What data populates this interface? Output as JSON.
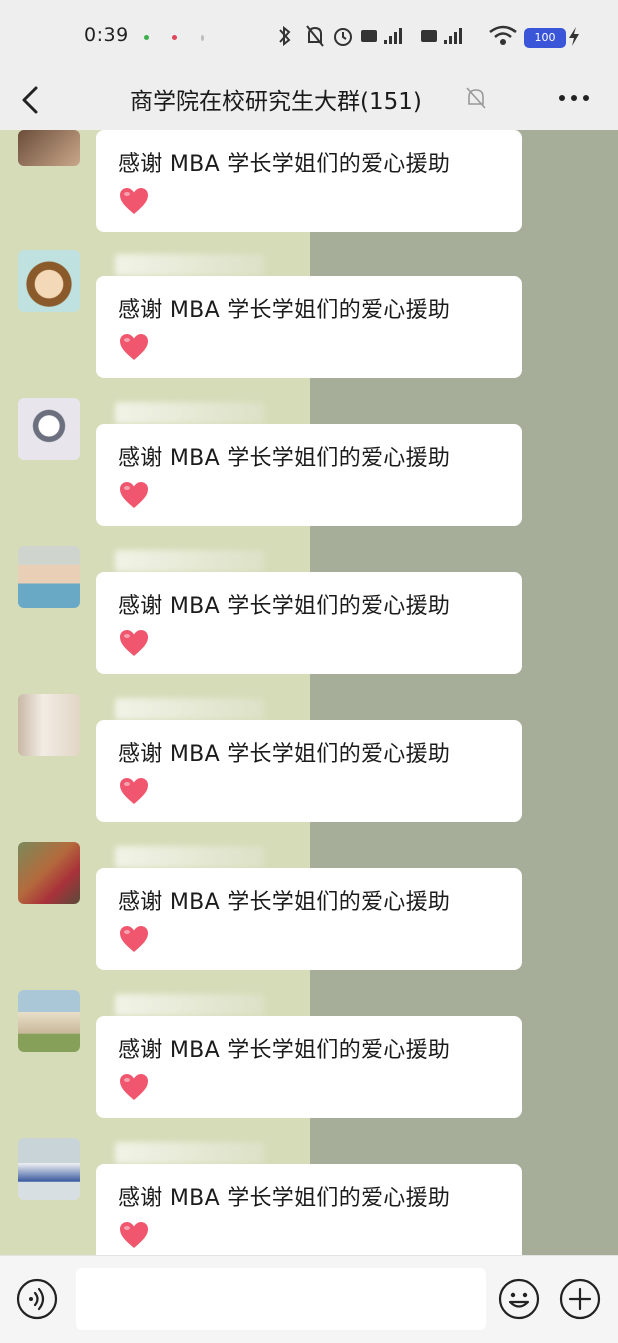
{
  "status_bar": {
    "time": "0:39",
    "battery": "100"
  },
  "header": {
    "title": "商学院在校研究生大群(151)",
    "back_icon": "chevron-left-icon",
    "mute_icon": "bell-muted-icon",
    "more_icon": "more-dots-icon"
  },
  "messages": [
    {
      "text": "感谢 MBA 学长学姐们的爱心援助",
      "emoji": "❤️"
    },
    {
      "text": "感谢 MBA 学长学姐们的爱心援助",
      "emoji": "❤️"
    },
    {
      "text": "感谢 MBA 学长学姐们的爱心援助",
      "emoji": "❤️"
    },
    {
      "text": "感谢 MBA 学长学姐们的爱心援助",
      "emoji": "❤️"
    },
    {
      "text": "感谢 MBA 学长学姐们的爱心援助",
      "emoji": "❤️"
    },
    {
      "text": "感谢 MBA 学长学姐们的爱心援助",
      "emoji": "❤️"
    },
    {
      "text": "感谢 MBA 学长学姐们的爱心援助",
      "emoji": "❤️"
    },
    {
      "text": "感谢 MBA 学长学姐们的爱心援助",
      "emoji": "❤️"
    }
  ],
  "input_bar": {
    "voice_icon": "voice-icon",
    "emoji_icon": "emoji-smile-icon",
    "plus_icon": "plus-circle-icon",
    "message_value": ""
  },
  "colors": {
    "bubble": "#ffffff",
    "heart": "#f0566e",
    "bg_left": "#d6dcb8",
    "bg_right": "#a6ad98"
  }
}
